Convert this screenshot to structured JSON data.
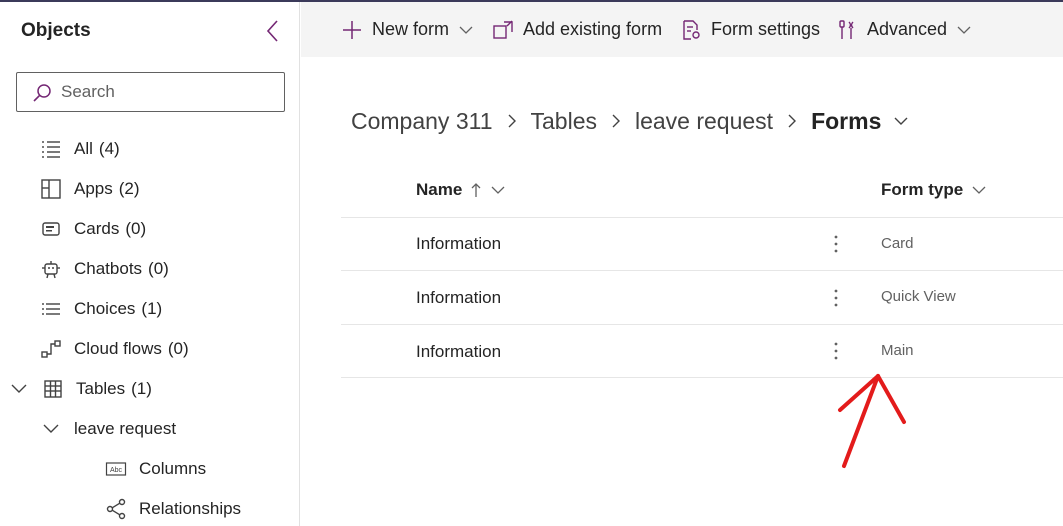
{
  "sidebar": {
    "title": "Objects",
    "search_placeholder": "Search",
    "items": [
      {
        "label": "All",
        "count": "(4)"
      },
      {
        "label": "Apps",
        "count": "(2)"
      },
      {
        "label": "Cards",
        "count": "(0)"
      },
      {
        "label": "Chatbots",
        "count": "(0)"
      },
      {
        "label": "Choices",
        "count": "(1)"
      },
      {
        "label": "Cloud flows",
        "count": "(0)"
      },
      {
        "label": "Tables",
        "count": "(1)"
      }
    ],
    "table_name": "leave request",
    "sub_items": [
      {
        "label": "Columns"
      },
      {
        "label": "Relationships"
      }
    ]
  },
  "toolbar": {
    "new_form": "New form",
    "add_existing_form": "Add existing form",
    "form_settings": "Form settings",
    "advanced": "Advanced"
  },
  "breadcrumb": {
    "items": [
      "Company 311",
      "Tables",
      "leave request"
    ],
    "current": "Forms"
  },
  "table": {
    "columns": {
      "name": "Name",
      "form_type": "Form type"
    },
    "rows": [
      {
        "name": "Information",
        "type": "Card"
      },
      {
        "name": "Information",
        "type": "Quick View"
      },
      {
        "name": "Information",
        "type": "Main"
      }
    ]
  },
  "colors": {
    "accent": "#742774",
    "annotation_arrow": "#e31b1b",
    "toolbar_bg": "#f4f4f4"
  }
}
